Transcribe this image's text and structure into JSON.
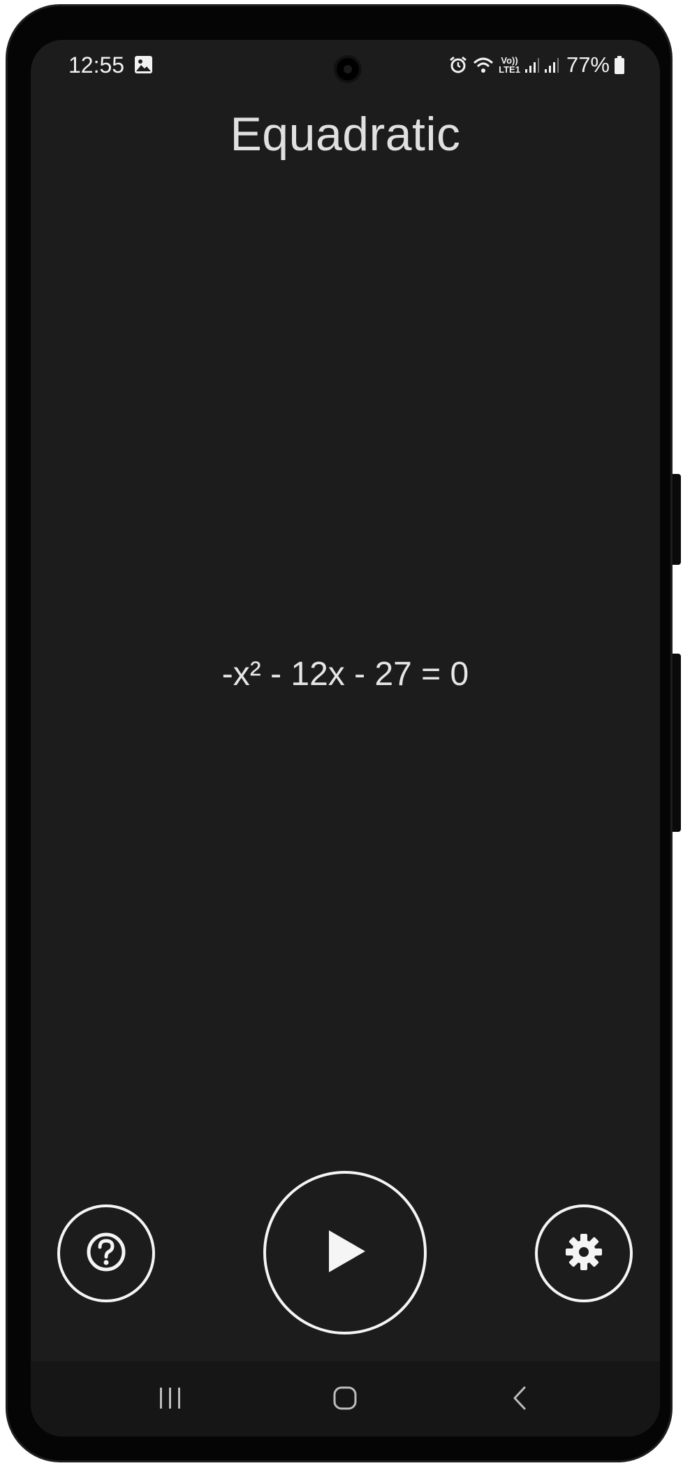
{
  "status_bar": {
    "time": "12:55",
    "lte_line1": "Vo))",
    "lte_line2": "LTE1",
    "battery_percent": "77%",
    "icons": [
      "gallery-icon",
      "alarm-icon",
      "wifi-icon",
      "signal-icon",
      "signal-icon",
      "battery-icon"
    ]
  },
  "app": {
    "title": "Equadratic",
    "equation": "-x² - 12x - 27 = 0"
  },
  "controls": {
    "help_icon": "help-circle-icon",
    "play_icon": "play-icon",
    "settings_icon": "gear-icon"
  },
  "navigation": {
    "recent_icon": "recent-apps-icon",
    "home_icon": "home-icon",
    "back_icon": "back-icon"
  },
  "colors": {
    "background": "#1c1c1c",
    "foreground": "#f5f5f5",
    "nav_background": "#161616"
  }
}
